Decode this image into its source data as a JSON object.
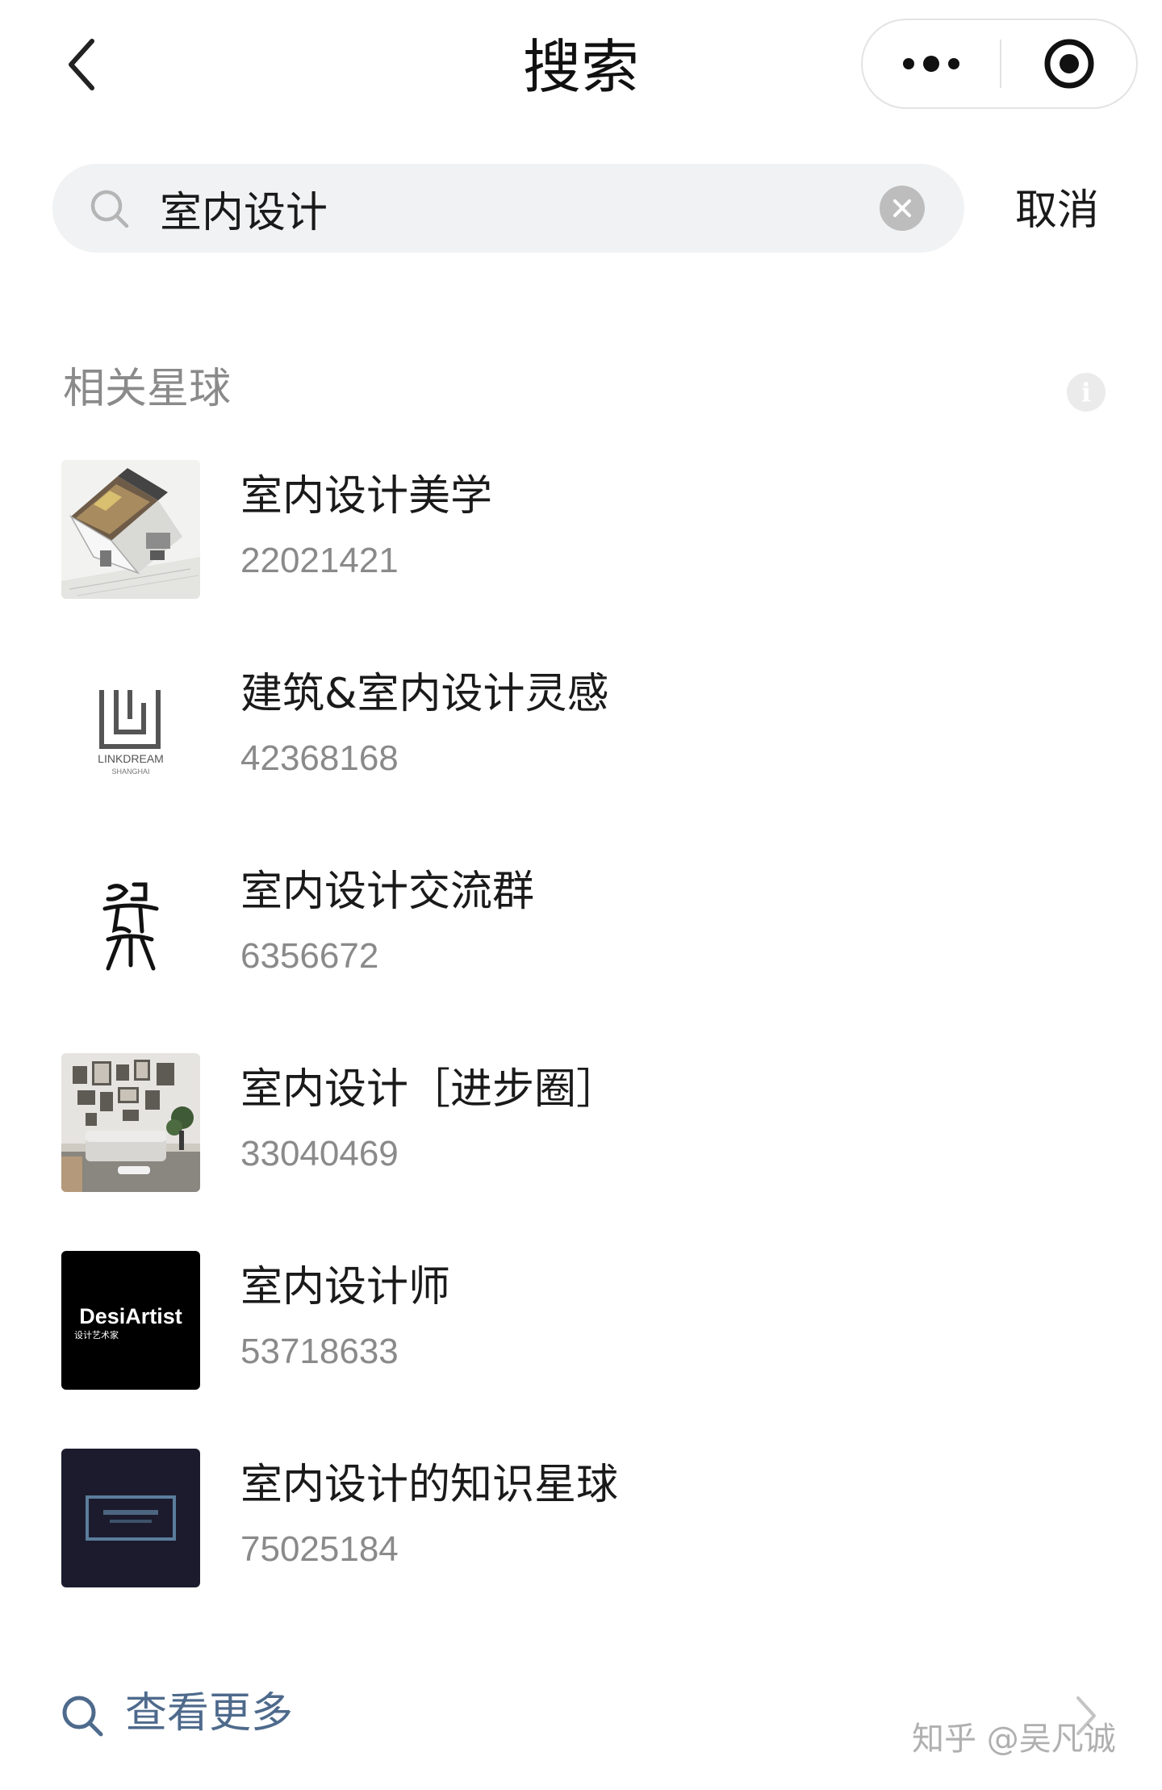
{
  "nav": {
    "title": "搜索",
    "back_icon": "chevron-left-icon",
    "more_icon": "more-dots-icon",
    "close_icon": "target-circle-icon"
  },
  "search": {
    "query": "室内设计",
    "cancel_label": "取消"
  },
  "section": {
    "title": "相关星球"
  },
  "results": [
    {
      "name": "室内设计美学",
      "id": "22021421",
      "thumb": "house-cutaway"
    },
    {
      "name": "建筑&室内设计灵感",
      "id": "42368168",
      "thumb": "linkdream-logo"
    },
    {
      "name": "室内设计交流群",
      "id": "6356672",
      "thumb": "calligraphy-logo"
    },
    {
      "name": "室内设计［进步圈］",
      "id": "33040469",
      "thumb": "living-room-photo"
    },
    {
      "name": "室内设计师",
      "id": "53718633",
      "thumb": "desiartist-logo"
    },
    {
      "name": "室内设计的知识星球",
      "id": "75025184",
      "thumb": "dark-frame-logo"
    }
  ],
  "thumb_text": {
    "linkdream_line1": "LINKDREAM",
    "linkdream_line2": "SHANGHAI",
    "desiartist_brand": "DesiArtist",
    "desiartist_sub": "设计艺术家"
  },
  "footer": {
    "see_more_label": "查看更多",
    "watermark": "知乎 @吴凡诚"
  },
  "colors": {
    "link": "#4e6a8c",
    "muted": "#8a8a8a",
    "search_bg": "#f1f2f3"
  }
}
